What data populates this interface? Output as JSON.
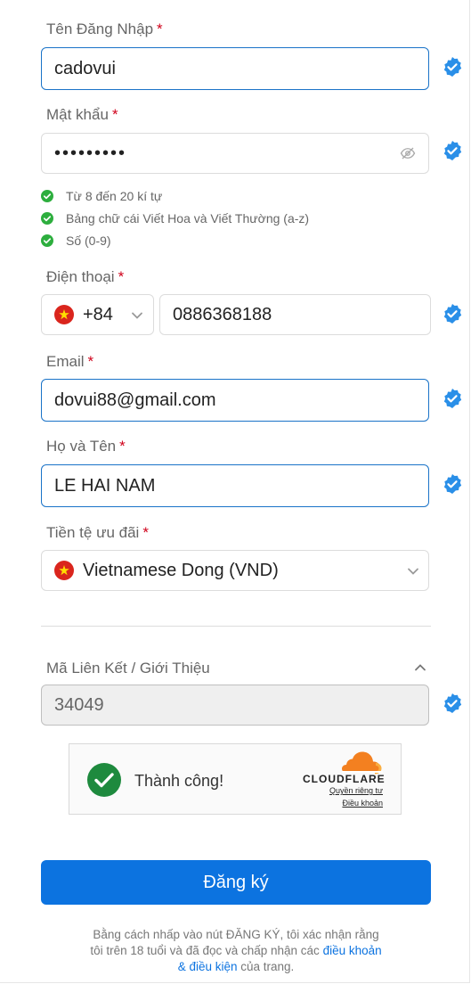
{
  "username": {
    "label": "Tên Đăng Nhập",
    "required_mark": "*",
    "value": "cadovui"
  },
  "password": {
    "label": "Mật khẩu",
    "required_mark": "*",
    "value": "•••••••••",
    "toggle_icon": "eye-off-icon"
  },
  "password_rules": [
    {
      "text": "Từ 8 đến 20 kí tự",
      "status": "passed"
    },
    {
      "text": "Bảng chữ cái Viết Hoa và Viết Thường (a-z)",
      "status": "passed"
    },
    {
      "text": "Số (0-9)",
      "status": "passed"
    }
  ],
  "phone": {
    "label": "Điện thoại",
    "required_mark": "*",
    "country_code": "+84",
    "country_flag": "vietnam-flag-icon",
    "value": "0886368188"
  },
  "email": {
    "label": "Email",
    "required_mark": "*",
    "value": "dovui88@gmail.com"
  },
  "fullname": {
    "label": "Họ và Tên",
    "required_mark": "*",
    "value": "LE HAI NAM"
  },
  "currency": {
    "label": "Tiền tệ ưu đãi",
    "required_mark": "*",
    "value": "Vietnamese Dong (VND)",
    "flag": "vietnam-flag-icon"
  },
  "referral": {
    "label": "Mã Liên Kết / Giới Thiệu",
    "value": "34049",
    "expanded": true
  },
  "captcha": {
    "status_text": "Thành công!",
    "provider": "CLOUDFLARE",
    "privacy_link": "Quyền riêng tư",
    "terms_link": "Điều khoản"
  },
  "submit_label": "Đăng ký",
  "terms_note": {
    "text_before": "Bằng cách nhấp vào nút ĐĂNG KÝ, tôi xác nhận rằng tôi trên 18 tuổi và đã đọc và chấp nhận các ",
    "link_text": "điều khoản & điều kiện",
    "text_after": " của trang."
  },
  "colors": {
    "accent": "#0c73e0",
    "verify": "#2a8fe8",
    "success": "#2dae3e",
    "required": "#d0021b",
    "cloudflare": "#f38020"
  }
}
